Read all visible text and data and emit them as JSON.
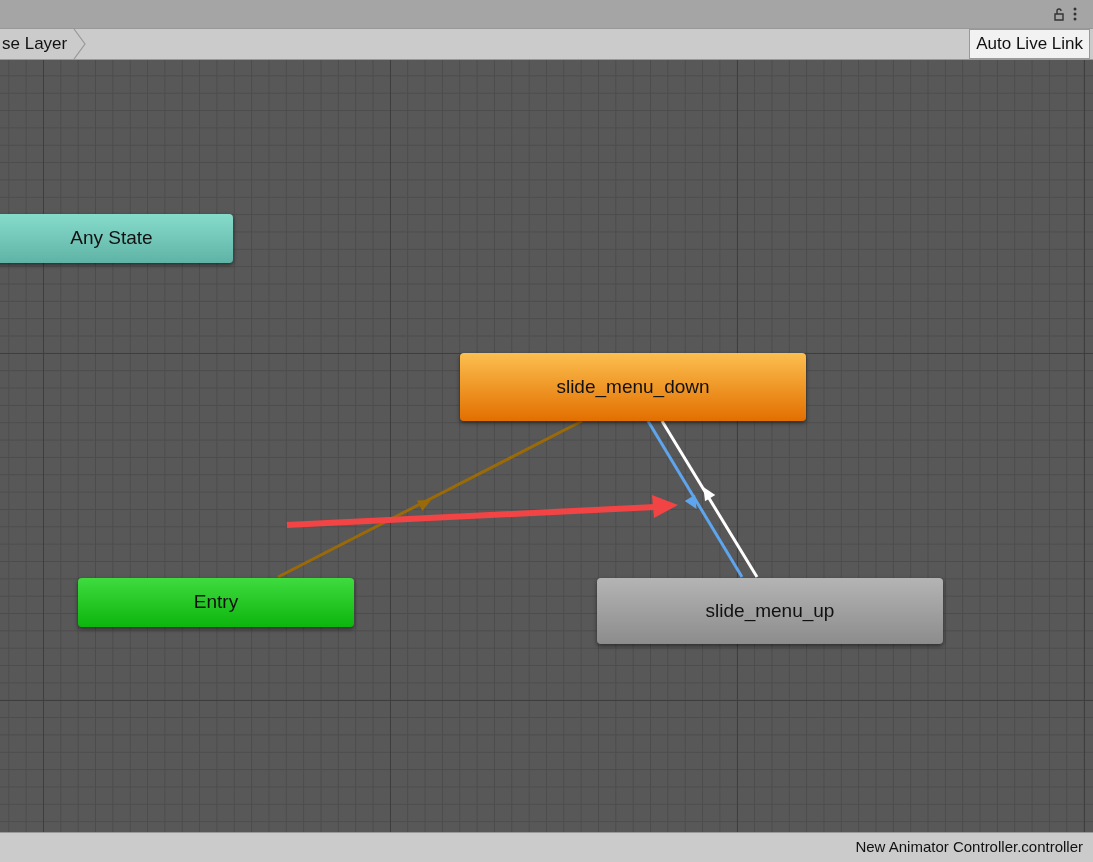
{
  "breadcrumb": {
    "label": "se Layer"
  },
  "toolbar": {
    "auto_live_link": {
      "label": "Auto Live Link",
      "selected": false
    }
  },
  "nodes": [
    {
      "kind": "any_state",
      "label": "Any State"
    },
    {
      "kind": "default",
      "label": "slide_menu_down"
    },
    {
      "kind": "entry",
      "label": "Entry"
    },
    {
      "kind": "state",
      "label": "slide_menu_up"
    }
  ],
  "transitions": [
    {
      "kind": "entry",
      "selected": false
    },
    {
      "kind": "normal",
      "selected": true
    },
    {
      "kind": "normal",
      "selected": false
    }
  ],
  "status_bar": {
    "file": "New Animator Controller.controller"
  }
}
